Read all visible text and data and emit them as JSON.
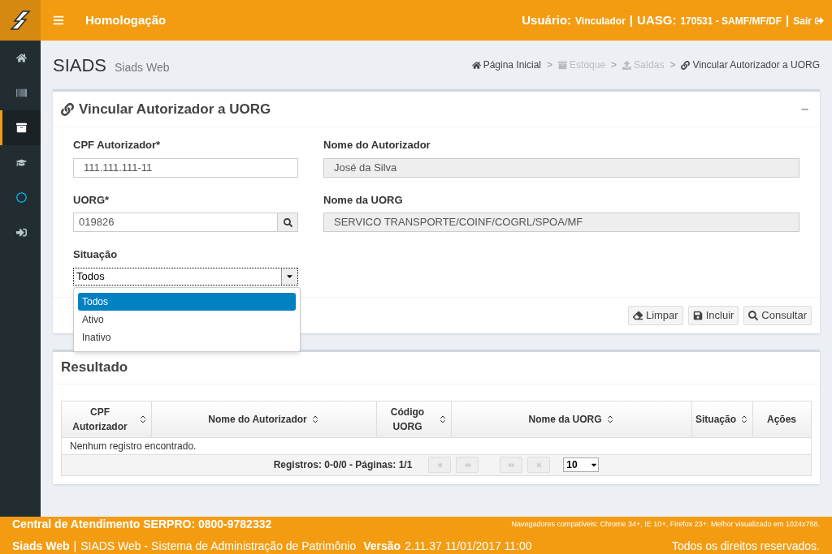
{
  "header": {
    "title": "Homologação",
    "user_label": "Usuário:",
    "user_value": "Vinculador",
    "separator_1": "|",
    "uasg_label": "UASG:",
    "uasg_value": "170531 - SAMF/MF/DF",
    "separator_2": "|",
    "logout": "Sair"
  },
  "sidebar": {
    "items": [
      {
        "kind": "home",
        "selected": false
      },
      {
        "kind": "barcode",
        "selected": false
      },
      {
        "kind": "archive",
        "selected": true
      },
      {
        "kind": "graduation",
        "selected": false
      },
      {
        "kind": "circle",
        "selected": false
      },
      {
        "kind": "signin",
        "selected": false
      }
    ]
  },
  "page": {
    "title": "SIADS",
    "subtitle": "Siads Web"
  },
  "breadcrumb": [
    {
      "kind": "home",
      "label": "Página Inicial",
      "disabled": false
    },
    {
      "kind": "separator",
      "label": ">"
    },
    {
      "kind": "archive",
      "label": "Estoque",
      "disabled": true
    },
    {
      "kind": "separator",
      "label": ">"
    },
    {
      "kind": "upload",
      "label": "Saídas",
      "disabled": true
    },
    {
      "kind": "separator",
      "label": ">"
    },
    {
      "kind": "link",
      "label": "Vincular Autorizador a UORG",
      "disabled": false
    }
  ],
  "form_panel": {
    "title": "Vincular Autorizador a UORG",
    "collapse": "−",
    "fields": [
      {
        "kind": "text",
        "label": "CPF Autorizador*",
        "value": "111.111.111-11"
      },
      {
        "kind": "readonly",
        "label": "Nome do Autorizador",
        "value": "José da Silva"
      },
      {
        "kind": "search",
        "label": "UORG*",
        "value": "019826"
      },
      {
        "kind": "readonly",
        "label": "Nome da UORG",
        "value": "SERVICO TRANSPORTE/COINF/COGRL/SPOA/MF"
      }
    ],
    "situacao": {
      "label": "Situação",
      "value": "Todos",
      "expanded": true,
      "options": [
        {
          "label": "Todos",
          "selected": true
        },
        {
          "label": "Ativo",
          "selected": false
        },
        {
          "label": "Inativo",
          "selected": false
        }
      ]
    },
    "buttons": [
      {
        "kind": "eraser",
        "label": "Limpar"
      },
      {
        "kind": "save",
        "label": "Incluir"
      },
      {
        "kind": "search",
        "label": "Consultar"
      }
    ]
  },
  "result_panel": {
    "title": "Resultado",
    "table": {
      "columns": [
        {
          "label": "CPF Autorizador",
          "sortable": true
        },
        {
          "label": "Nome do Autorizador",
          "sortable": true
        },
        {
          "label": "Código UORG",
          "sortable": true
        },
        {
          "label": "Nome da UORG",
          "sortable": true
        },
        {
          "label": "Situação",
          "sortable": true
        },
        {
          "label": "Ações",
          "sortable": false
        }
      ],
      "empty_message": "Nenhum registro encontrado.",
      "pagination": {
        "summary": "Registros: 0-0/0 - Páginas: 1/1",
        "buttons": [
          {
            "kind": "first",
            "disabled": true
          },
          {
            "kind": "prev",
            "disabled": true
          },
          {
            "kind": "next",
            "disabled": true
          },
          {
            "kind": "last",
            "disabled": true
          }
        ],
        "page_size": "10"
      }
    }
  },
  "footer": {
    "support": "Central de Atendimento SERPRO: 0800-9782332",
    "browsers": "Navegadores compatíveis: Chrome 34+, IE 10+, Firefox 23+. Melhor visualizado em 1024x768.",
    "app_name": "Siads Web",
    "separator": "|",
    "system": "SIADS Web - Sistema de Administração de Patrimônio",
    "version_label": "Versão",
    "version": "2.11.37 11/01/2017 11:00",
    "rights": "Todos os direitos reservados."
  }
}
